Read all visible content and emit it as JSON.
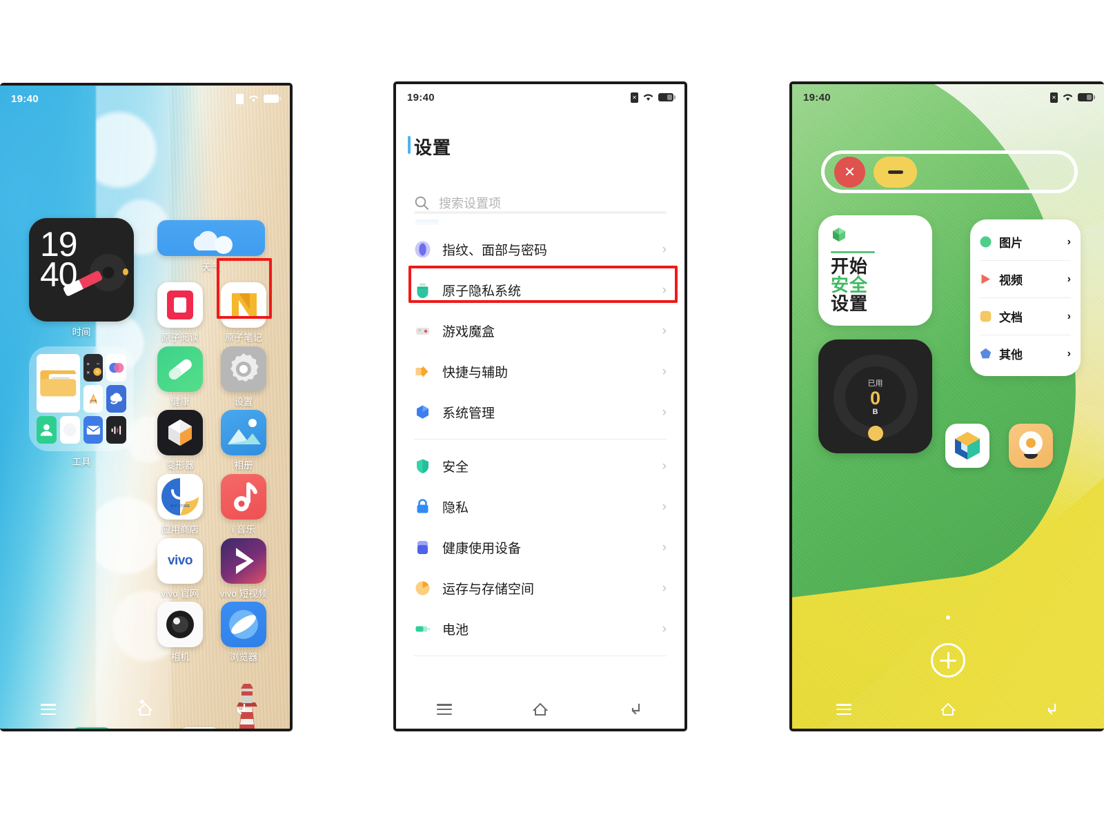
{
  "statusbar": {
    "time": "19:40",
    "icons": [
      "sim-no-card-icon",
      "wifi-icon",
      "battery-icon"
    ]
  },
  "navbar": {
    "recent_label": "recent-apps",
    "home_label": "home",
    "back_label": "back"
  },
  "phone1": {
    "name": "home-screen",
    "widget": {
      "hour": "19",
      "minute": "40",
      "label": "时间"
    },
    "folder": {
      "label": "工具"
    },
    "apps": [
      {
        "label": "天气",
        "icon": "weather-icon"
      },
      {
        "label": "原子阅读",
        "icon": "atomic-reading-icon"
      },
      {
        "label": "原子笔记",
        "icon": "atomic-notes-icon"
      },
      {
        "label": "健康",
        "icon": "health-icon"
      },
      {
        "label": "设置",
        "icon": "settings-gear-icon"
      },
      {
        "label": "变形器",
        "icon": "transformer-icon"
      },
      {
        "label": "相册",
        "icon": "gallery-icon"
      },
      {
        "label": "应用商店",
        "icon": "app-store-icon"
      },
      {
        "label": "i 音乐",
        "icon": "imusic-icon"
      },
      {
        "label": "vivo 官网",
        "icon": "vivo-official-icon"
      },
      {
        "label": "vivo 短视频",
        "icon": "vivo-shortvideo-icon"
      },
      {
        "label": "相机",
        "icon": "camera-icon"
      },
      {
        "label": "浏览器",
        "icon": "browser-icon"
      }
    ],
    "dock": [
      {
        "label": "phone",
        "icon": "phone-dialer-icon"
      },
      {
        "label": "messages",
        "icon": "messages-icon"
      }
    ],
    "highlight_color": "#ee1a19"
  },
  "phone2": {
    "name": "settings-screen",
    "title": "设置",
    "search_placeholder": "搜索设置项",
    "groups": [
      {
        "items": [
          {
            "label": "指纹、面部与密码",
            "icon": "fingerprint-icon",
            "color": "#8e8df0",
            "highlighted": false
          },
          {
            "label": "原子隐私系统",
            "icon": "atomic-privacy-icon",
            "color": "#2ec4a0",
            "highlighted": true
          },
          {
            "label": "游戏魔盒",
            "icon": "game-box-icon",
            "color": "#d8d8d8",
            "highlighted": false
          },
          {
            "label": "快捷与辅助",
            "icon": "shortcut-assist-icon",
            "color": "#f5a623",
            "highlighted": false
          },
          {
            "label": "系统管理",
            "icon": "system-manage-icon",
            "color": "#3b7ef0",
            "highlighted": false
          }
        ]
      },
      {
        "items": [
          {
            "label": "安全",
            "icon": "security-shield-icon",
            "color": "#34d3ab",
            "highlighted": false
          },
          {
            "label": "隐私",
            "icon": "privacy-lock-icon",
            "color": "#2f8cf5",
            "highlighted": false
          },
          {
            "label": "健康使用设备",
            "icon": "digital-wellbeing-icon",
            "color": "#5a6ef0",
            "highlighted": false
          },
          {
            "label": "运存与存储空间",
            "icon": "storage-icon",
            "color": "#f7b955",
            "highlighted": false
          },
          {
            "label": "电池",
            "icon": "battery-setting-icon",
            "color": "#2ecf9a",
            "highlighted": false
          }
        ]
      }
    ],
    "chevron": "›",
    "highlight_color": "#ee1a19"
  },
  "phone3": {
    "name": "atomic-privacy-home",
    "window_bar": {
      "close_label": "✕",
      "minimize_label": "—"
    },
    "start_card": {
      "icon": "cube-icon",
      "lines": [
        "开始",
        "安全",
        "设置"
      ],
      "accent_color": "#3dbb63"
    },
    "file_list": [
      {
        "label": "图片",
        "color": "#4fce8b",
        "shape": "circle",
        "icon": "pictures-icon"
      },
      {
        "label": "视频",
        "color": "#ee6a5a",
        "shape": "triangle",
        "icon": "videos-icon"
      },
      {
        "label": "文档",
        "color": "#f5c765",
        "shape": "circle",
        "icon": "documents-icon"
      },
      {
        "label": "其他",
        "color": "#5a8ae0",
        "shape": "pentagon",
        "icon": "others-icon"
      }
    ],
    "usage_card": {
      "caption": "已用",
      "value": "0",
      "unit": "B"
    },
    "apps": [
      {
        "label": "files-cube-app",
        "icon": "cube-app-icon"
      },
      {
        "label": "flashlight-app",
        "icon": "bulb-app-icon"
      }
    ],
    "add_button_label": "+",
    "page_indicator_dots": 1
  }
}
